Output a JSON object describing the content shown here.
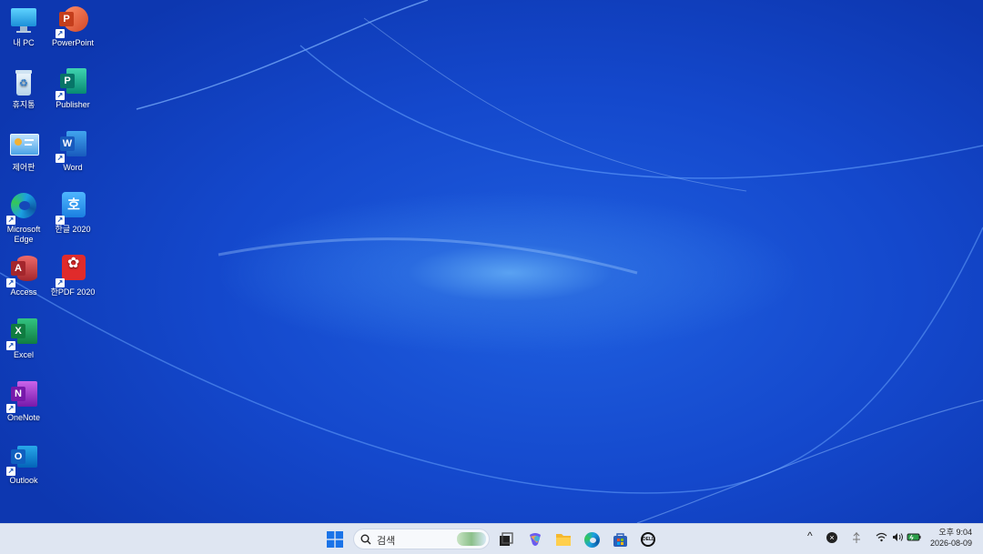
{
  "desktop": {
    "icons": [
      {
        "label": "내 PC"
      },
      {
        "label": "PowerPoint"
      },
      {
        "label": "휴지통"
      },
      {
        "label": "Publisher"
      },
      {
        "label": "제어판"
      },
      {
        "label": "Word"
      },
      {
        "label": "Microsoft Edge"
      },
      {
        "label": "한글 2020"
      },
      {
        "label": "Access"
      },
      {
        "label": "한PDF 2020"
      },
      {
        "label": "Excel"
      },
      {
        "label": "OneNote"
      },
      {
        "label": "Outlook"
      }
    ]
  },
  "taskbar": {
    "search_placeholder": "검색",
    "pinned": [
      "start-icon",
      "task-view-icon",
      "copilot-icon",
      "file-explorer-icon",
      "edge-icon",
      "store-icon",
      "dell-icon"
    ],
    "tray": {
      "chevron": "^"
    },
    "clock": {
      "time": "오후 9:04",
      "date": "2026-08-09"
    }
  },
  "colors": {
    "accent": "#1448cc",
    "taskbar": "#dfe6f2"
  }
}
